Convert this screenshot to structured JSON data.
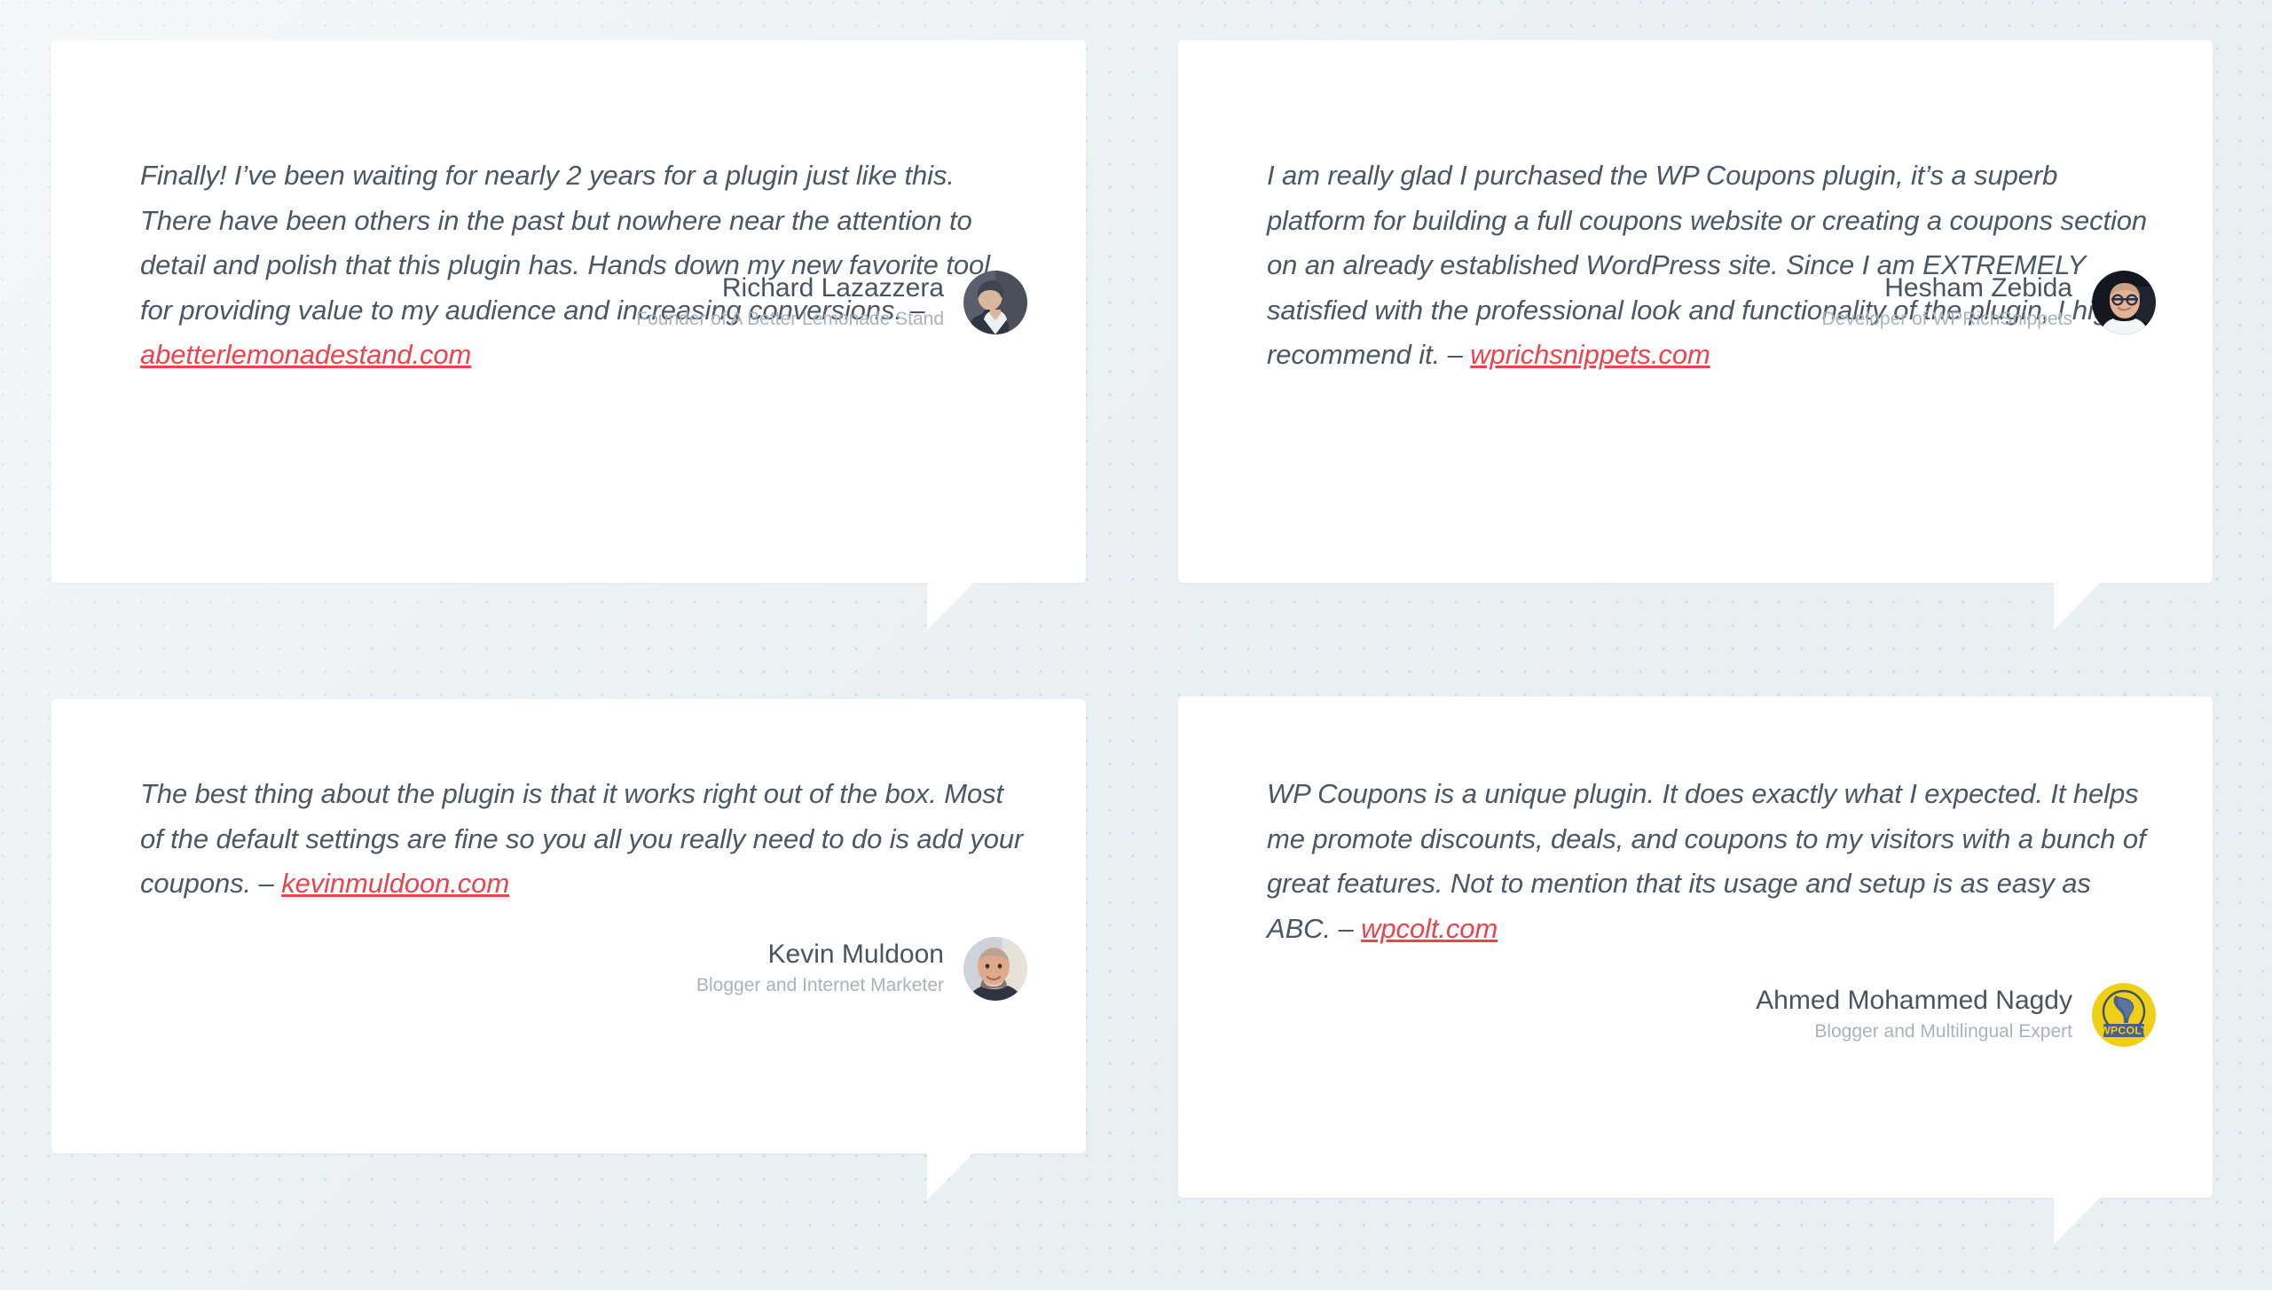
{
  "theme": {
    "page_background": "#eaeff2",
    "card_background": "#ffffff",
    "quote_text_color": "#4b5763",
    "link_color": "#e8454f",
    "author_name_color": "#49545f",
    "author_role_color": "#a9b3bc"
  },
  "testimonials": [
    {
      "id": "testimonial-richard-lazazzera",
      "quote_text": "Finally! I’ve been waiting for nearly 2 years for a plugin just like this. There have been others in the past but nowhere near the attention to detail and polish that this plugin has. Hands down my new favorite tool for providing value to my audience and increasing conversions. – ",
      "source_link": "abetterlemonadestand.com",
      "author_name": "Richard Lazazzera",
      "author_role": "Founder of A Better Lemonade Stand",
      "avatar_icon": "avatar-photo-richard"
    },
    {
      "id": "testimonial-hesham-zebida",
      "quote_text": "I am really glad I purchased the WP Coupons plugin, it’s a superb platform for building a full coupons website or creating a coupons section on an already established WordPress site. Since I am EXTREMELY satisfied with the professional look and functionality of the plugin, I highly recommend it. – ",
      "source_link": "wprichsnippets.com",
      "author_name": "Hesham Zebida",
      "author_role": "Developer of WPRichSnippets",
      "avatar_icon": "avatar-photo-hesham"
    },
    {
      "id": "testimonial-kevin-muldoon",
      "quote_text": "The best thing about the plugin is that it works right out of the box. Most of the default settings are fine so you all you really need to do is add your coupons. – ",
      "source_link": "kevinmuldoon.com",
      "author_name": "Kevin Muldoon",
      "author_role": "Blogger and Internet Marketer",
      "avatar_icon": "avatar-photo-kevin"
    },
    {
      "id": "testimonial-ahmed-mohammed-nagdy",
      "quote_text": "WP Coupons is a unique plugin. It does exactly what I expected. It helps me promote discounts, deals, and coupons to my visitors with a bunch of great features. Not to mention that its usage and setup is as easy as ABC. – ",
      "source_link": "wpcolt.com",
      "author_name": "Ahmed Mohammed Nagdy",
      "author_role": "Blogger and Multilingual Expert",
      "avatar_icon": "avatar-logo-wpcolt",
      "avatar_logo_text": "WPCOLT",
      "avatar_logo_colors": {
        "background": "#f0d017",
        "mark": "#46618f"
      }
    }
  ]
}
